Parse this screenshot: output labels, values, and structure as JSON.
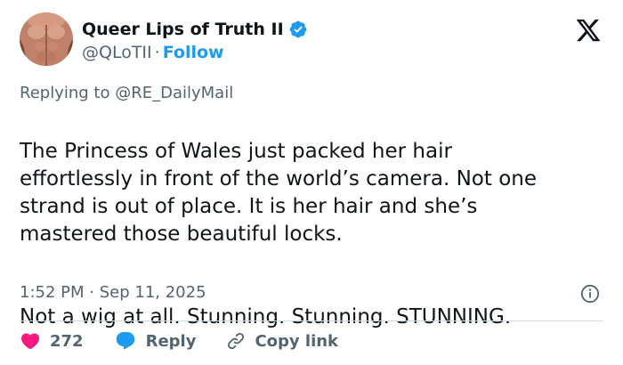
{
  "author": {
    "display_name": "Queer Lips of Truth II",
    "handle": "@QLoTII",
    "separator": "·",
    "follow_label": "Follow",
    "verified_icon": "verified-badge-icon"
  },
  "platform_icon": "x-logo-icon",
  "reply_context": {
    "prefix": "Replying to",
    "handle": "@RE_DailyMail"
  },
  "tweet": {
    "paragraph_1": "The Princess of Wales just packed her hair\neffortlessly in front of the world’s camera. Not one\nstrand is out of place.  It is her hair and she’s\nmastered those beautiful locks.",
    "paragraph_2": "Not a wig at all.  Stunning. Stunning.  STUNNING."
  },
  "meta": {
    "time": "1:52 PM",
    "separator": "·",
    "date": "Sep 11, 2025",
    "info_icon": "info-icon"
  },
  "actions": {
    "like_count": "272",
    "reply_label": "Reply",
    "copy_link_label": "Copy link"
  },
  "colors": {
    "accent": "#1d9bf0",
    "like": "#f91880",
    "text": "#0f1419",
    "secondary": "#536471",
    "divider": "#cfd9de"
  }
}
